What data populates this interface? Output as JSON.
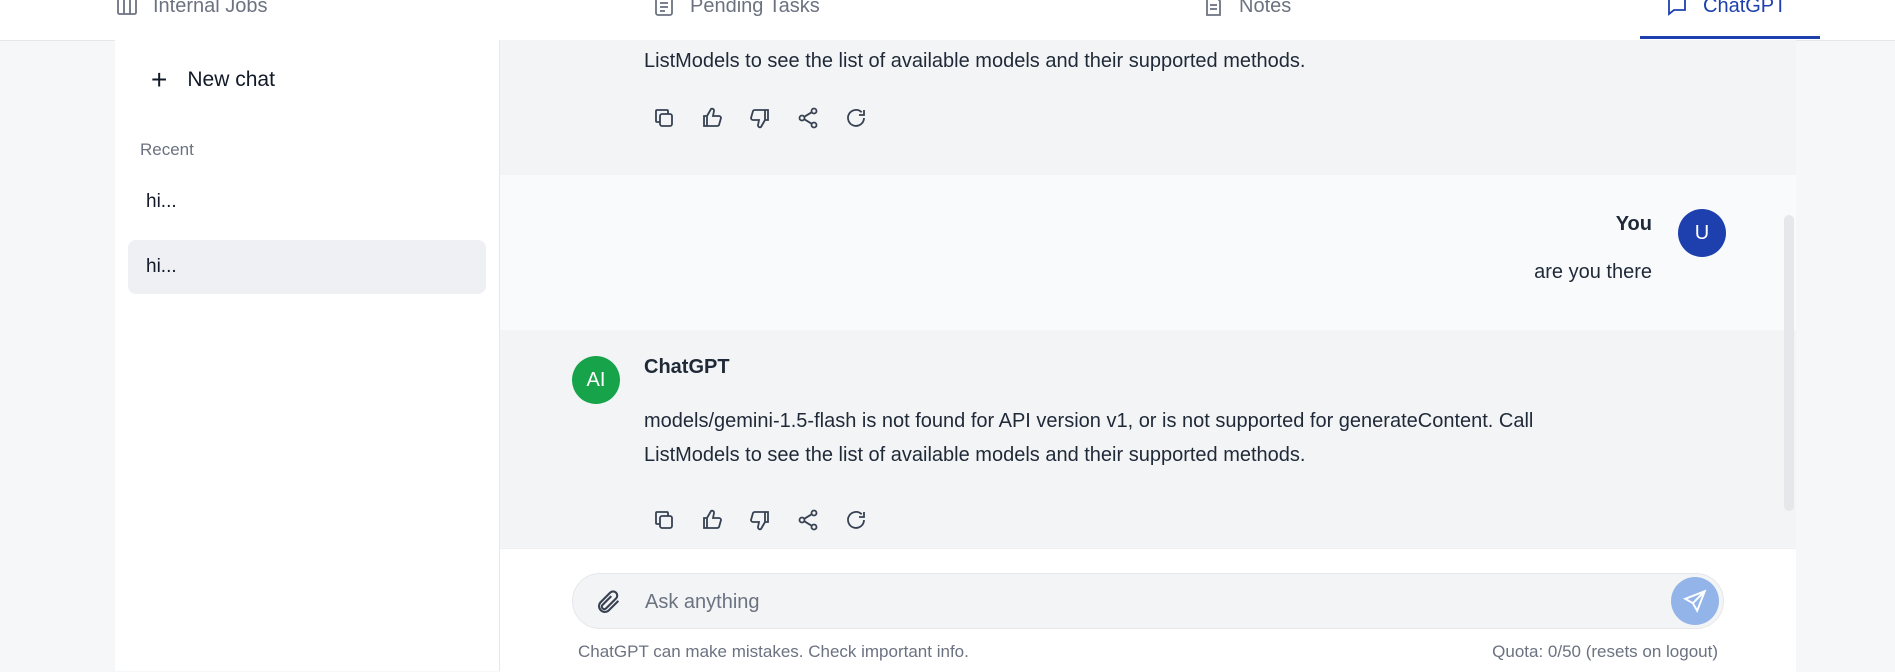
{
  "tabs": [
    {
      "label": "Internal Jobs",
      "icon": "columns-icon"
    },
    {
      "label": "Pending Tasks",
      "icon": "clipboard-list-icon"
    },
    {
      "label": "Notes",
      "icon": "document-icon"
    },
    {
      "label": "ChatGPT",
      "icon": "chat-bubble-icon",
      "active": true
    }
  ],
  "sidebar": {
    "new_chat_label": "New chat",
    "recent_label": "Recent",
    "recent_items": [
      "hi...",
      "hi..."
    ]
  },
  "messages": {
    "ai_top_text": "ListModels to see the list of available models and their supported methods.",
    "user_name": "You",
    "user_avatar": "U",
    "user_text": "are you there",
    "ai_name": "ChatGPT",
    "ai_avatar": "AI",
    "ai_text_line1": "models/gemini-1.5-flash is not found for API version v1, or is not supported for generateContent. Call",
    "ai_text_line2": "ListModels to see the list of available models and their supported methods."
  },
  "composer": {
    "placeholder": "Ask anything",
    "value": "",
    "disclaimer": "ChatGPT can make mistakes. Check important info.",
    "quota": "Quota: 0/50 (resets on logout)"
  },
  "colors": {
    "accent": "#1e40af",
    "ai_avatar": "#16a34a",
    "send_button": "#93b4e8"
  }
}
